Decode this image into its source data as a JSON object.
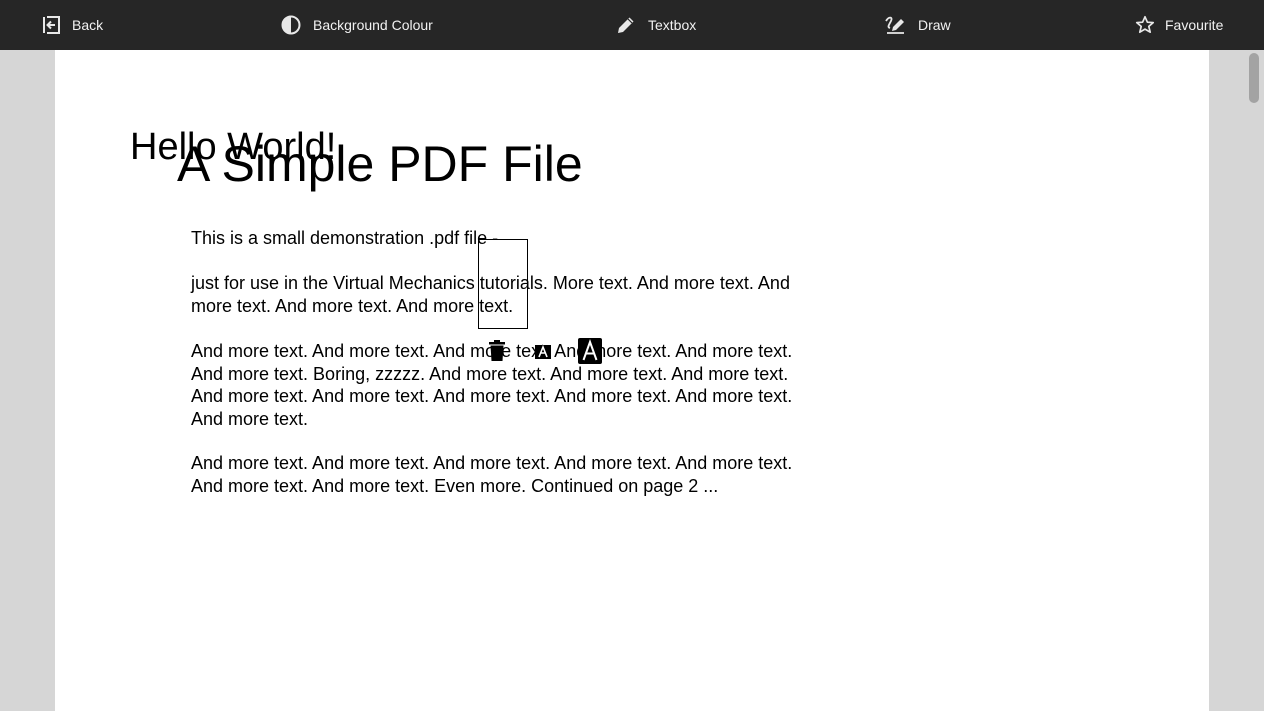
{
  "toolbar": {
    "back_label": "Back",
    "background_label": "Background Colour",
    "textbox_label": "Textbox",
    "draw_label": "Draw",
    "favourite_label": "Favourite"
  },
  "document": {
    "title": "A Simple PDF File",
    "annotation_text": "Hello World!",
    "paragraphs": [
      "This is a small demonstration .pdf file -",
      "just for use in the Virtual Mechanics tutorials. More text. And more text. And more text. And more text. And more text.",
      "And more text. And more text. And more text. And more text. And more text. And more text. Boring, zzzzz. And more text. And more text. And more text. And more text. And more text. And more text. And more text. And more text. And more text.",
      "And more text. And more text. And more text. And more text. And more text. And more text. And more text. Even more. Continued on page 2 ..."
    ]
  },
  "colors": {
    "toolbar_bg": "#262626",
    "viewer_bg": "#d6d6d6",
    "page_bg": "#ffffff"
  },
  "icons": {
    "back": "exit-arrow-icon",
    "background": "contrast-circle-icon",
    "textbox": "pencil-icon",
    "draw": "draw-pen-icon",
    "favourite": "star-outline-icon",
    "delete": "trash-icon",
    "font_smaller": "font-size-decrease-icon",
    "font_larger": "font-size-increase-icon"
  }
}
